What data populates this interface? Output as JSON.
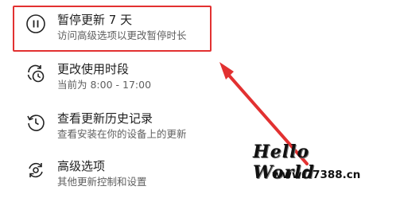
{
  "menu": {
    "items": [
      {
        "title": "暂停更新 7 天",
        "subtitle": "访问高级选项以更改暂停时长",
        "icon": "pause-icon"
      },
      {
        "title": "更改使用时段",
        "subtitle": "当前为 8:00 - 17:00",
        "icon": "active-hours-icon"
      },
      {
        "title": "查看更新历史记录",
        "subtitle": "查看安装在你的设备上的更新",
        "icon": "history-icon"
      },
      {
        "title": "高级选项",
        "subtitle": "其他更新控制和设置",
        "icon": "advanced-options-icon"
      }
    ]
  },
  "annotation": {
    "color": "#e23131"
  },
  "watermark": {
    "title": "Hello World",
    "url": "www.77388.cn"
  }
}
